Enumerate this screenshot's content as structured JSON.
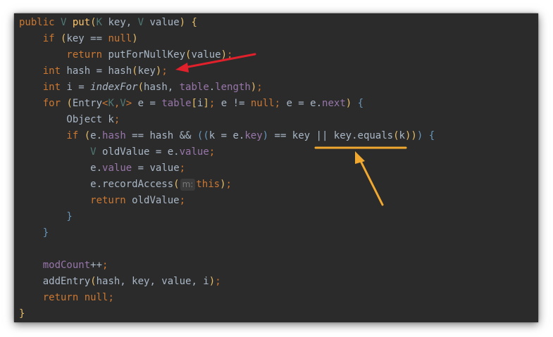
{
  "editor": {
    "lines": [
      [
        {
          "t": "public ",
          "c": "keyword"
        },
        {
          "t": "V ",
          "c": "generic"
        },
        {
          "t": "put",
          "c": "method"
        },
        {
          "t": "(",
          "c": "bracket-y"
        },
        {
          "t": "K ",
          "c": "generic"
        },
        {
          "t": "key, ",
          "c": "param"
        },
        {
          "t": "V ",
          "c": "generic"
        },
        {
          "t": "value",
          "c": "param"
        },
        {
          "t": ") ",
          "c": "bracket-y"
        },
        {
          "t": "{",
          "c": "bracket-y"
        }
      ],
      [
        {
          "t": "    if ",
          "c": "keyword"
        },
        {
          "t": "(",
          "c": "bracket-y"
        },
        {
          "t": "key == ",
          "c": "type"
        },
        {
          "t": "null",
          "c": "keyword"
        },
        {
          "t": ")",
          "c": "bracket-y"
        }
      ],
      [
        {
          "t": "        return ",
          "c": "keyword"
        },
        {
          "t": "putForNullKey",
          "c": "type"
        },
        {
          "t": "(",
          "c": "bracket-y"
        },
        {
          "t": "value",
          "c": "type"
        },
        {
          "t": ")",
          "c": "bracket-y"
        },
        {
          "t": ";",
          "c": "keyword"
        }
      ],
      [
        {
          "t": "    int ",
          "c": "keyword"
        },
        {
          "t": "hash = ",
          "c": "type"
        },
        {
          "t": "hash",
          "c": "type"
        },
        {
          "t": "(",
          "c": "bracket-y"
        },
        {
          "t": "key",
          "c": "type"
        },
        {
          "t": ")",
          "c": "bracket-y"
        },
        {
          "t": ";",
          "c": "keyword"
        }
      ],
      [
        {
          "t": "    int ",
          "c": "keyword"
        },
        {
          "t": "i = ",
          "c": "type"
        },
        {
          "t": "indexFor",
          "c": "italic"
        },
        {
          "t": "(",
          "c": "bracket-y"
        },
        {
          "t": "hash, ",
          "c": "type"
        },
        {
          "t": "table",
          "c": "field"
        },
        {
          "t": ".",
          "c": "type"
        },
        {
          "t": "length",
          "c": "field"
        },
        {
          "t": ")",
          "c": "bracket-y"
        },
        {
          "t": ";",
          "c": "keyword"
        }
      ],
      [
        {
          "t": "    for ",
          "c": "keyword"
        },
        {
          "t": "(",
          "c": "bracket-y"
        },
        {
          "t": "Entry",
          "c": "type"
        },
        {
          "t": "<",
          "c": "keyword"
        },
        {
          "t": "K",
          "c": "generic"
        },
        {
          "t": ",",
          "c": "keyword"
        },
        {
          "t": "V",
          "c": "generic"
        },
        {
          "t": "> ",
          "c": "keyword"
        },
        {
          "t": "e",
          "c": "u"
        },
        {
          "t": " = ",
          "c": "type"
        },
        {
          "t": "table",
          "c": "field"
        },
        {
          "t": "[",
          "c": "bracket-y"
        },
        {
          "t": "i",
          "c": "type"
        },
        {
          "t": "]",
          "c": "bracket-y"
        },
        {
          "t": "; ",
          "c": "keyword"
        },
        {
          "t": "e",
          "c": "u"
        },
        {
          "t": " != ",
          "c": "type"
        },
        {
          "t": "null",
          "c": "keyword"
        },
        {
          "t": "; ",
          "c": "keyword"
        },
        {
          "t": "e",
          "c": "u"
        },
        {
          "t": " = ",
          "c": "type"
        },
        {
          "t": "e",
          "c": "u"
        },
        {
          "t": ".",
          "c": "type"
        },
        {
          "t": "next",
          "c": "field"
        },
        {
          "t": ") ",
          "c": "bracket-y"
        },
        {
          "t": "{",
          "c": "bracket-b"
        }
      ],
      [
        {
          "t": "        Object k",
          "c": "type"
        },
        {
          "t": ";",
          "c": "keyword"
        }
      ],
      [
        {
          "t": "        if ",
          "c": "keyword"
        },
        {
          "t": "(",
          "c": "bracket-y"
        },
        {
          "t": "e",
          "c": "u"
        },
        {
          "t": ".",
          "c": "type"
        },
        {
          "t": "hash",
          "c": "field"
        },
        {
          "t": " == hash && ",
          "c": "type"
        },
        {
          "t": "((",
          "c": "bracket-b"
        },
        {
          "t": "k = ",
          "c": "type"
        },
        {
          "t": "e",
          "c": "u"
        },
        {
          "t": ".",
          "c": "type"
        },
        {
          "t": "key",
          "c": "field"
        },
        {
          "t": ")",
          "c": "bracket-b"
        },
        {
          "t": " == key || key.equals",
          "c": "type"
        },
        {
          "t": "(",
          "c": "bracket-y"
        },
        {
          "t": "k",
          "c": "type"
        },
        {
          "t": "))",
          "c": "bracket-y"
        },
        {
          "t": ") ",
          "c": "bracket-b"
        },
        {
          "t": "{",
          "c": "bracket-b"
        }
      ],
      [
        {
          "t": "            V ",
          "c": "generic"
        },
        {
          "t": "oldValue = ",
          "c": "type"
        },
        {
          "t": "e",
          "c": "u"
        },
        {
          "t": ".",
          "c": "type"
        },
        {
          "t": "value",
          "c": "field"
        },
        {
          "t": ";",
          "c": "keyword"
        }
      ],
      [
        {
          "t": "            ",
          "c": "type"
        },
        {
          "t": "e",
          "c": "u"
        },
        {
          "t": ".",
          "c": "type"
        },
        {
          "t": "value",
          "c": "field"
        },
        {
          "t": " = value",
          "c": "type"
        },
        {
          "t": ";",
          "c": "keyword"
        }
      ],
      [
        {
          "t": "            ",
          "c": "type"
        },
        {
          "t": "e",
          "c": "u"
        },
        {
          "t": ".recordAccess",
          "c": "type"
        },
        {
          "t": "(",
          "c": "bracket-y"
        },
        {
          "t": "m:",
          "c": "hint"
        },
        {
          "t": "this",
          "c": "keyword"
        },
        {
          "t": ")",
          "c": "bracket-y"
        },
        {
          "t": ";",
          "c": "keyword"
        }
      ],
      [
        {
          "t": "            return ",
          "c": "keyword"
        },
        {
          "t": "oldValue",
          "c": "type"
        },
        {
          "t": ";",
          "c": "keyword"
        }
      ],
      [
        {
          "t": "        }",
          "c": "bracket-b"
        }
      ],
      [
        {
          "t": "    }",
          "c": "bracket-b"
        }
      ],
      [
        {
          "t": "",
          "c": "type"
        }
      ],
      [
        {
          "t": "    ",
          "c": "type"
        },
        {
          "t": "modCount",
          "c": "field"
        },
        {
          "t": "++",
          "c": "type"
        },
        {
          "t": ";",
          "c": "keyword"
        }
      ],
      [
        {
          "t": "    addEntry",
          "c": "type"
        },
        {
          "t": "(",
          "c": "bracket-y"
        },
        {
          "t": "hash, key, value, i",
          "c": "type"
        },
        {
          "t": ")",
          "c": "bracket-y"
        },
        {
          "t": ";",
          "c": "keyword"
        }
      ],
      [
        {
          "t": "    return ",
          "c": "keyword"
        },
        {
          "t": "null",
          "c": "keyword"
        },
        {
          "t": ";",
          "c": "keyword"
        }
      ],
      [
        {
          "t": "}",
          "c": "bracket-y"
        }
      ]
    ]
  },
  "annotations": {
    "red_arrow_color": "#e0202a",
    "orange_color": "#f0a830",
    "red_arrow_target": "int hash = hash(key);",
    "orange_underline_target": "key.equals(k)"
  }
}
